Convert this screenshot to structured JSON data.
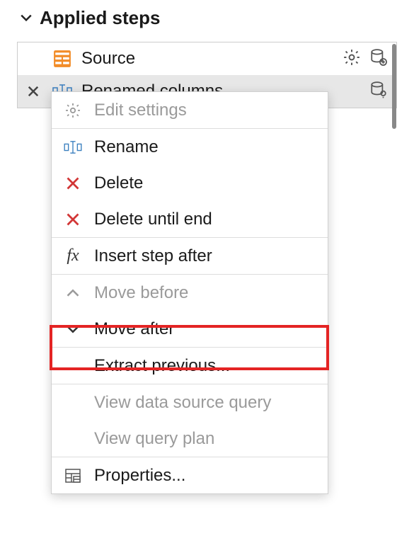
{
  "panel": {
    "title": "Applied steps"
  },
  "steps": [
    {
      "label": "Source"
    },
    {
      "label": "Renamed columns"
    }
  ],
  "menu": {
    "edit_settings": "Edit settings",
    "rename": "Rename",
    "delete": "Delete",
    "delete_until_end": "Delete until end",
    "insert_step_after": "Insert step after",
    "move_before": "Move before",
    "move_after": "Move after",
    "extract_previous": "Extract previous...",
    "view_data_source_query": "View data source query",
    "view_query_plan": "View query plan",
    "properties": "Properties..."
  }
}
